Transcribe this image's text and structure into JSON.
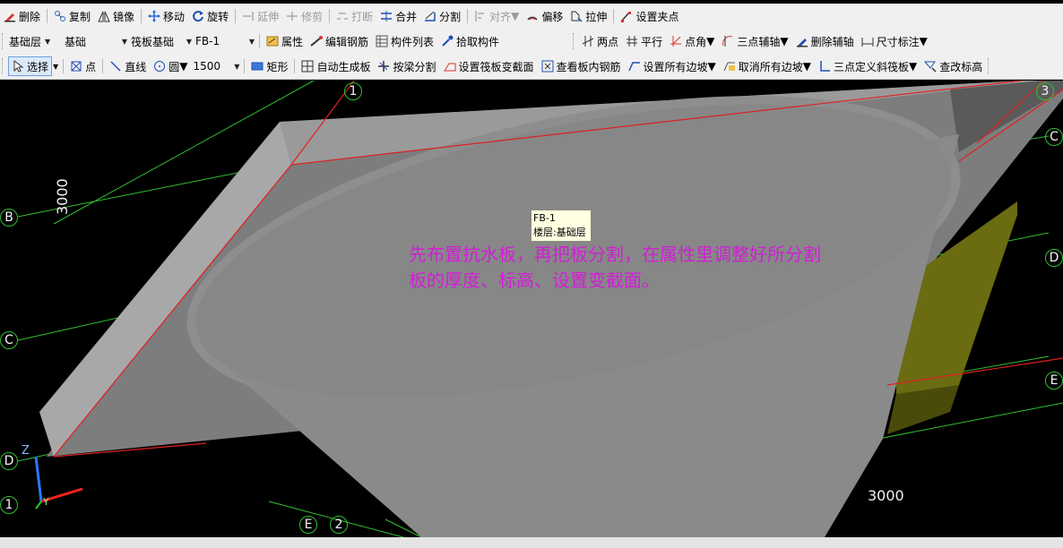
{
  "toolbar1": {
    "delete": "删除",
    "copy": "复制",
    "mirror": "镜像",
    "move": "移动",
    "rotate": "旋转",
    "extend": "延伸",
    "trim": "修剪",
    "break": "打断",
    "merge": "合并",
    "split": "分割",
    "align": "对齐",
    "offset": "偏移",
    "stretch": "拉伸",
    "set_grip": "设置夹点"
  },
  "toolbar2": {
    "floor": "基础层",
    "category": "基础",
    "component_type": "筏板基础",
    "component": "FB-1",
    "properties": "属性",
    "edit_rebar": "编辑钢筋",
    "component_list": "构件列表",
    "pick_component": "拾取构件",
    "two_point": "两点",
    "parallel": "平行",
    "point_angle": "点角",
    "three_point_axis": "三点辅轴",
    "delete_axis": "删除辅轴",
    "dimension": "尺寸标注"
  },
  "toolbar3": {
    "select": "选择",
    "point": "点",
    "line": "直线",
    "circle": "圆",
    "radius": "1500",
    "rectangle": "矩形",
    "auto_generate": "自动生成板",
    "split_by_beam": "按梁分割",
    "set_section": "设置筏板变截面",
    "view_rebar": "查看板内钢筋",
    "set_all_slopes": "设置所有边坡",
    "cancel_all_slopes": "取消所有边坡",
    "three_point_slope": "三点定义斜筏板",
    "check_elevation": "查改标高"
  },
  "viewport": {
    "tooltip_name": "FB-1",
    "tooltip_floor": "楼层:基础层",
    "annotation_line1": "先布置抗水板，再把板分割，在属性里调整好所分割",
    "annotation_line2": "板的厚度、标高、设置变截面。",
    "dim_vertical": "3000",
    "dim_bottom": "3000",
    "axis_z": "Z",
    "axis_y": "Y",
    "grid_1_top": "1",
    "grid_3": "3",
    "grid_b": "B",
    "grid_c_left": "C",
    "grid_c_right": "C",
    "grid_d_left": "D",
    "grid_d_right": "D",
    "grid_e_right": "E",
    "grid_1_bottom": "1",
    "grid_e_bottom": "E",
    "grid_2": "2"
  },
  "colors": {
    "toolbar_bg": "#f0f0f0",
    "annotation": "#d11fd6",
    "grid_line": "#2fc02f",
    "edge_red": "#e02020",
    "slab_gray": "#8a8a8a",
    "yellow_wall": "#6b6b12"
  }
}
